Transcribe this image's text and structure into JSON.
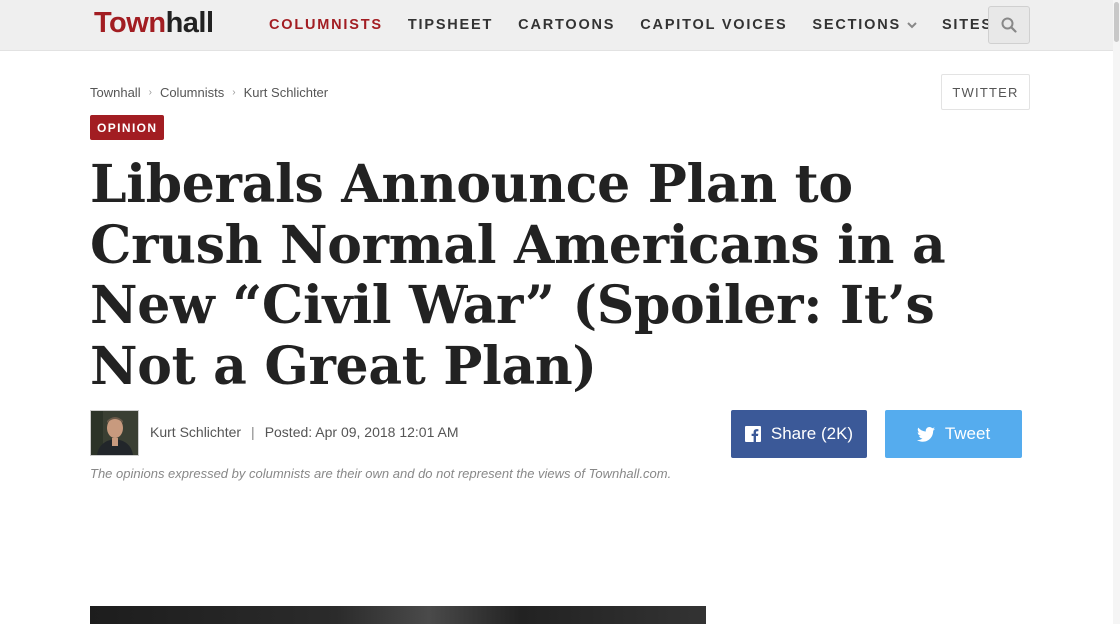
{
  "header": {
    "logo_town": "Town",
    "logo_hall": "hall",
    "nav": [
      {
        "label": "COLUMNISTS",
        "active": true
      },
      {
        "label": "TIPSHEET"
      },
      {
        "label": "CARTOONS"
      },
      {
        "label": "CAPITOL VOICES"
      },
      {
        "label": "SECTIONS",
        "dropdown": true
      },
      {
        "label": "SITES",
        "dropdown": true
      }
    ],
    "search_icon": "search-icon"
  },
  "breadcrumb": [
    "Townhall",
    "Columnists",
    "Kurt Schlichter"
  ],
  "twitter_button": "TWITTER",
  "badge": "OPINION",
  "headline": "Liberals Announce Plan to Crush Normal Americans in a New “Civil War” (Spoiler: It’s Not a Great Plan)",
  "byline": {
    "author": "Kurt Schlichter",
    "separator": "|",
    "posted": "Posted: Apr 09, 2018 12:01 AM"
  },
  "share": {
    "facebook_label": "Share (2K)",
    "twitter_label": "Tweet"
  },
  "disclaimer": "The opinions expressed by columnists are their own and do not represent the views of Townhall.com.",
  "colors": {
    "brand": "#a21d22",
    "facebook": "#3b5998",
    "twitter": "#55acee"
  }
}
